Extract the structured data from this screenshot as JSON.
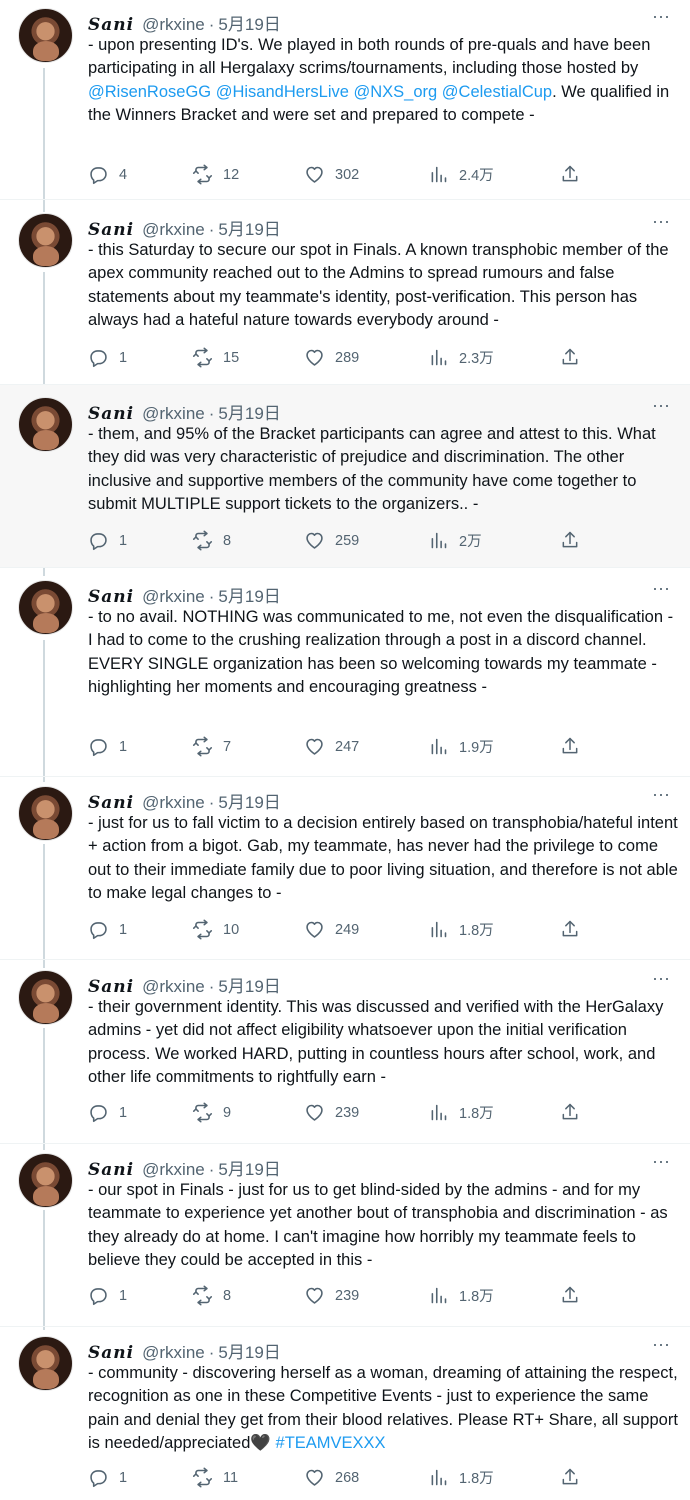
{
  "tweets": [
    {
      "name": "Sani",
      "handle": "@rkxine",
      "date": "5月19日",
      "text_before": "- upon presenting ID's. We played in both rounds of pre-quals and have been participating in all Hergalaxy scrims/tournaments, including those hosted by ",
      "mentions": "@RisenRoseGG @HisandHersLive @NXS_org @CelestialCup",
      "text_after": ". We qualified in the Winners Bracket and were set and prepared to compete -",
      "replies": "4",
      "retweets": "12",
      "likes": "302",
      "views": "2.4万"
    },
    {
      "name": "Sani",
      "handle": "@rkxine",
      "date": "5月19日",
      "text": "- this Saturday to secure our spot in Finals. A known transphobic member of the apex community reached out to the Admins to spread rumours and false statements about my teammate's identity, post-verification. This person has always had a hateful nature towards everybody around -",
      "replies": "1",
      "retweets": "15",
      "likes": "289",
      "views": "2.3万"
    },
    {
      "name": "Sani",
      "handle": "@rkxine",
      "date": "5月19日",
      "text": "- them, and 95% of the Bracket participants can agree and attest to this. What they did was very characteristic of prejudice and discrimination. The other inclusive and supportive members of the community have come together to submit MULTIPLE support tickets to the organizers.. -",
      "replies": "1",
      "retweets": "8",
      "likes": "259",
      "views": "2万"
    },
    {
      "name": "Sani",
      "handle": "@rkxine",
      "date": "5月19日",
      "text": "- to no avail. NOTHING was communicated to me, not even the disqualification - I had to come to the crushing realization through a post in a discord channel. EVERY SINGLE organization has been so welcoming towards my teammate - highlighting her moments and encouraging greatness -",
      "replies": "1",
      "retweets": "7",
      "likes": "247",
      "views": "1.9万"
    },
    {
      "name": "Sani",
      "handle": "@rkxine",
      "date": "5月19日",
      "text": "- just for us to fall victim to a decision entirely based on transphobia/hateful intent + action from a bigot. Gab, my teammate, has never had the privilege to come out to their immediate family due to poor living situation, and therefore is not able to make legal changes to -",
      "replies": "1",
      "retweets": "10",
      "likes": "249",
      "views": "1.8万"
    },
    {
      "name": "Sani",
      "handle": "@rkxine",
      "date": "5月19日",
      "text": "- their government identity. This was discussed and verified with the HerGalaxy admins - yet did not affect eligibility whatsoever upon the initial verification process. We worked HARD, putting in countless hours after school, work, and other life commitments to rightfully earn -",
      "replies": "1",
      "retweets": "9",
      "likes": "239",
      "views": "1.8万"
    },
    {
      "name": "Sani",
      "handle": "@rkxine",
      "date": "5月19日",
      "text": "- our spot in Finals - just for us to get blind-sided by the admins - and for my teammate to experience yet another bout of transphobia and discrimination - as they already do at home. I can't imagine how horribly my teammate feels to believe they could be accepted in this -",
      "replies": "1",
      "retweets": "8",
      "likes": "239",
      "views": "1.8万"
    },
    {
      "name": "Sani",
      "handle": "@rkxine",
      "date": "5月19日",
      "text_before": "- community - discovering herself as a woman, dreaming of attaining the respect, recognition as one in these Competitive Events - just to experience the same pain and denial they get from their blood relatives. Please RT+ Share, all support is needed/appreciated",
      "emoji": "🖤",
      "hashtag": "#TEAMVEXXX",
      "replies": "1",
      "retweets": "11",
      "likes": "268",
      "views": "1.8万"
    }
  ],
  "ui": {
    "more_glyph": "···",
    "separator": "·"
  },
  "colors": {
    "link": "#1d9bf0",
    "secondary_text": "#536471",
    "highlight_bg": "#f7f7f7"
  }
}
